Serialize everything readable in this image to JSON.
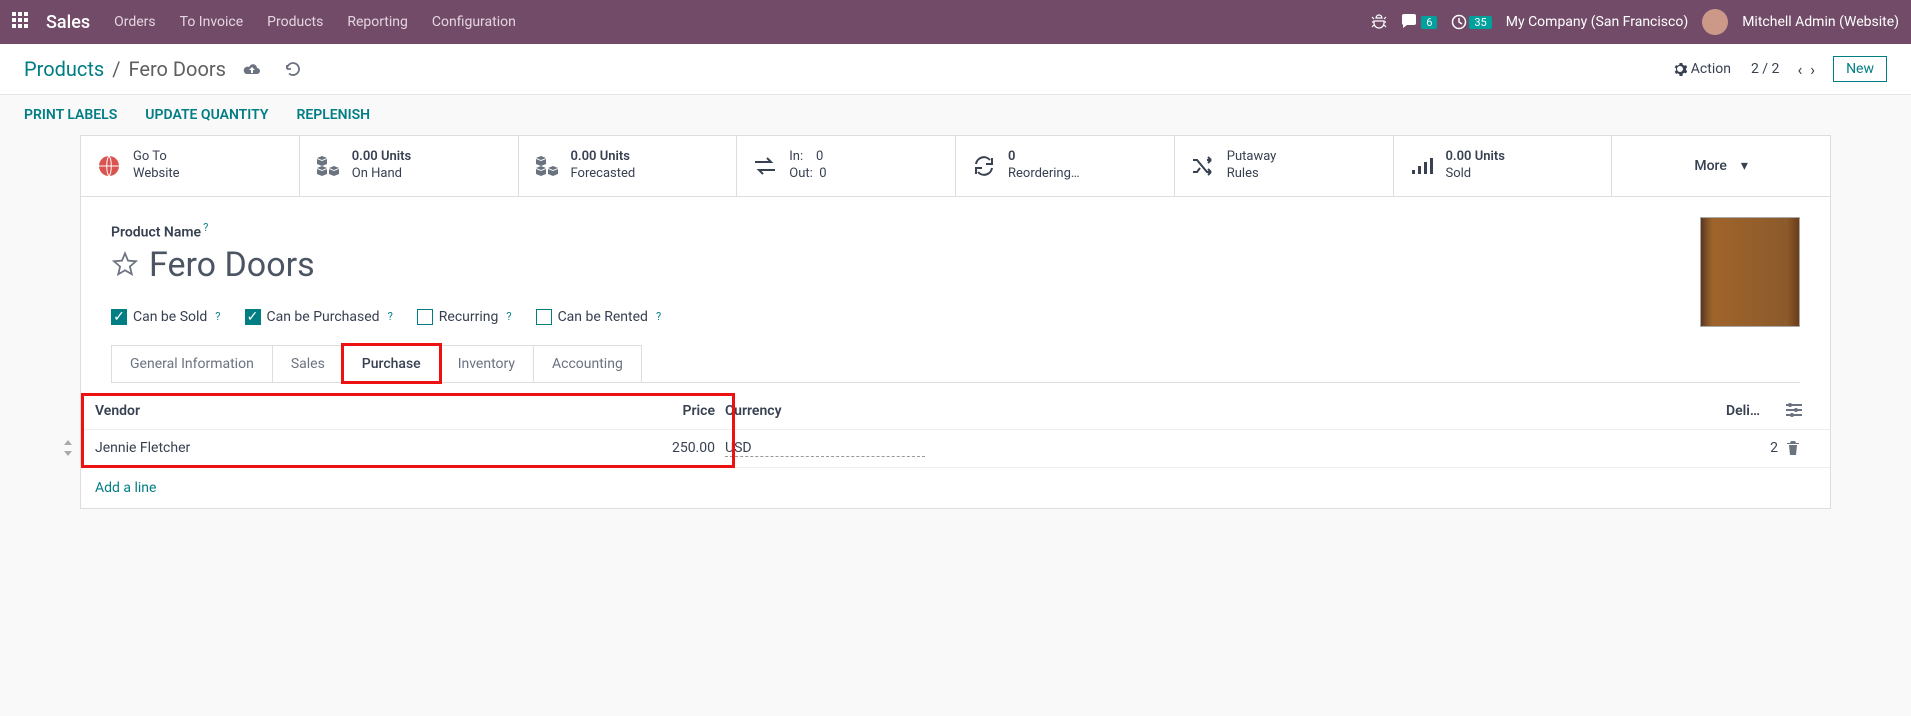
{
  "topbar": {
    "brand": "Sales",
    "nav": [
      "Orders",
      "To Invoice",
      "Products",
      "Reporting",
      "Configuration"
    ],
    "msg_count": "6",
    "timer_count": "35",
    "company": "My Company (San Francisco)",
    "user": "Mitchell Admin (Website)"
  },
  "breadcrumb": {
    "parent": "Products",
    "current": "Fero Doors"
  },
  "header_actions": {
    "action": "Action",
    "pager": "2 / 2",
    "new": "New"
  },
  "actionbar": [
    "PRINT LABELS",
    "UPDATE QUANTITY",
    "REPLENISH"
  ],
  "stats": {
    "goto_top": "Go To",
    "goto_bot": "Website",
    "onhand_top": "0.00 Units",
    "onhand_bot": "On Hand",
    "forecast_top": "0.00 Units",
    "forecast_bot": "Forecasted",
    "in_label": "In:",
    "in_val": "0",
    "out_label": "Out:",
    "out_val": "0",
    "reorder_top": "0",
    "reorder_bot": "Reordering…",
    "putaway_top": "Putaway",
    "putaway_bot": "Rules",
    "sold_top": "0.00 Units",
    "sold_bot": "Sold",
    "more": "More"
  },
  "product": {
    "name_label": "Product Name",
    "title": "Fero Doors",
    "can_sold": "Can be Sold",
    "can_purchased": "Can be Purchased",
    "recurring": "Recurring",
    "can_rented": "Can be Rented"
  },
  "tabs": [
    "General Information",
    "Sales",
    "Purchase",
    "Inventory",
    "Accounting"
  ],
  "active_tab_index": 2,
  "table": {
    "headers": {
      "vendor": "Vendor",
      "price": "Price",
      "currency": "Currency",
      "deli": "Deli…"
    },
    "row": {
      "vendor": "Jennie Fletcher",
      "price": "250.00",
      "currency": "USD",
      "deli": "2"
    },
    "add_line": "Add a line"
  }
}
